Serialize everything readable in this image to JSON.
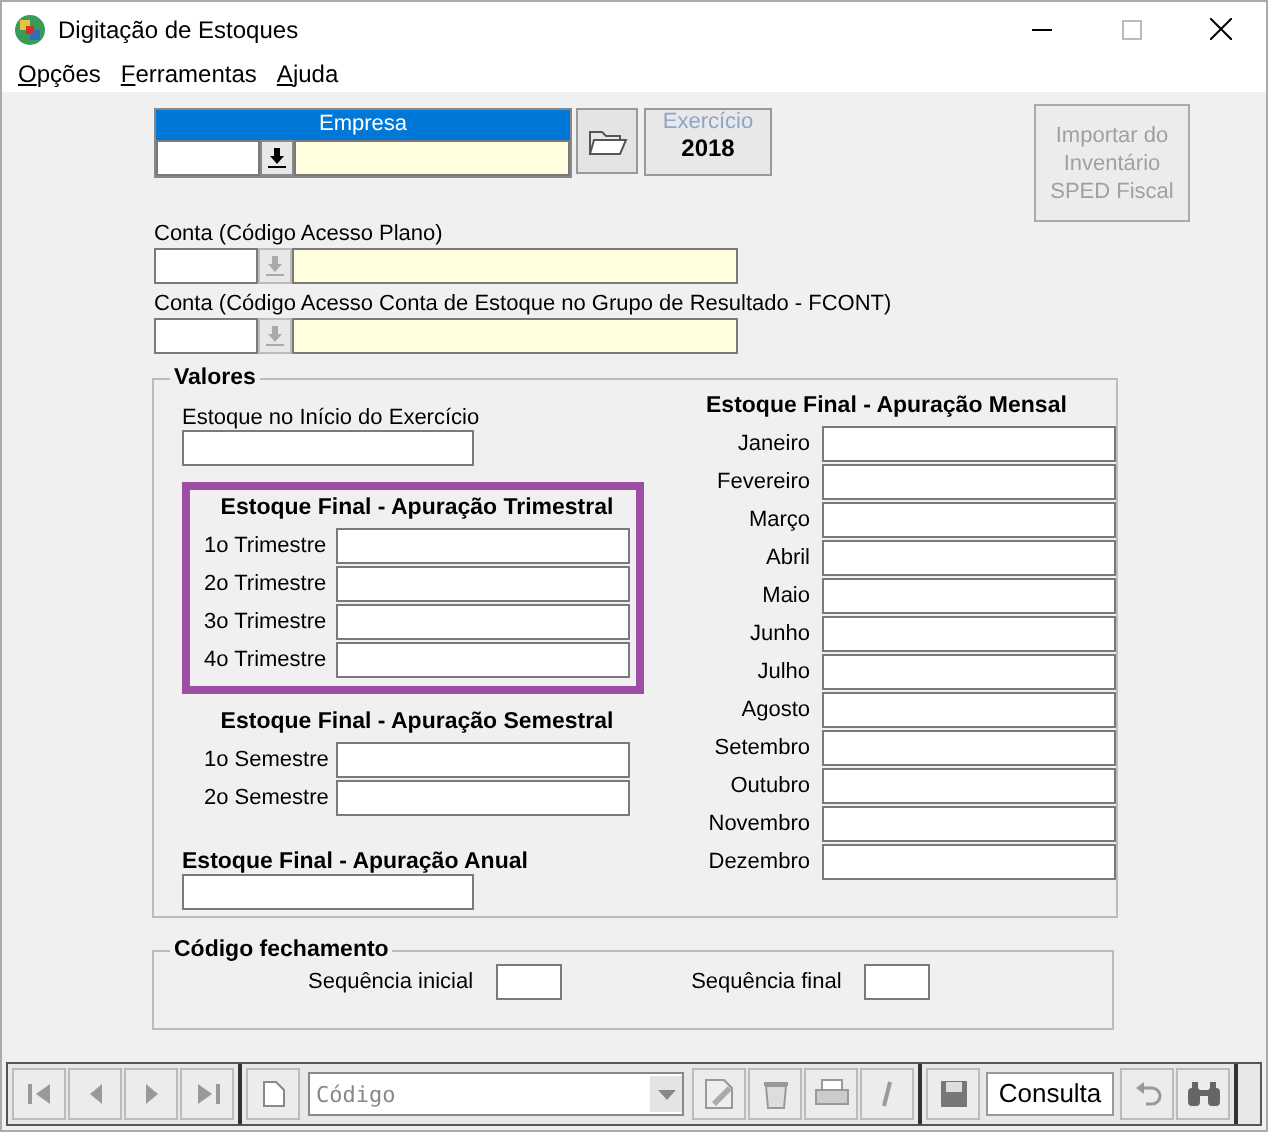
{
  "window": {
    "title": "Digitação de Estoques"
  },
  "menu": [
    {
      "label": "Opções"
    },
    {
      "label": "Ferramentas"
    },
    {
      "label": "Ajuda"
    }
  ],
  "empresa": {
    "header": "Empresa"
  },
  "exercicio": {
    "label": "Exercício",
    "value": "2018"
  },
  "import_button": {
    "label": "Importar do Inventário SPED Fiscal",
    "disabled": true
  },
  "contas": [
    {
      "label": "Conta (Código Acesso Plano)"
    },
    {
      "label": "Conta (Código Acesso Conta de Estoque no Grupo de Resultado - FCONT)"
    }
  ],
  "valores": {
    "title": "Valores",
    "inicio": {
      "label": "Estoque no Início do Exercício"
    },
    "trimestral": {
      "title": "Estoque Final - Apuração Trimestral",
      "highlighted": true,
      "rows": [
        {
          "label": "1o Trimestre"
        },
        {
          "label": "2o Trimestre"
        },
        {
          "label": "3o Trimestre"
        },
        {
          "label": "4o Trimestre"
        }
      ]
    },
    "semestral": {
      "title": "Estoque Final - Apuração Semestral",
      "rows": [
        {
          "label": "1o Semestre"
        },
        {
          "label": "2o Semestre"
        }
      ]
    },
    "anual": {
      "title": "Estoque Final - Apuração Anual"
    },
    "mensal": {
      "title": "Estoque Final - Apuração Mensal",
      "rows": [
        {
          "label": "Janeiro"
        },
        {
          "label": "Fevereiro"
        },
        {
          "label": "Março"
        },
        {
          "label": "Abril"
        },
        {
          "label": "Maio"
        },
        {
          "label": "Junho"
        },
        {
          "label": "Julho"
        },
        {
          "label": "Agosto"
        },
        {
          "label": "Setembro"
        },
        {
          "label": "Outubro"
        },
        {
          "label": "Novembro"
        },
        {
          "label": "Dezembro"
        }
      ]
    }
  },
  "codigo_fechamento": {
    "title": "Código fechamento",
    "fields": [
      {
        "label": "Sequência inicial"
      },
      {
        "label": "Sequência final"
      }
    ]
  },
  "toolbar": {
    "search": {
      "placeholder": "Código"
    },
    "mode": "Consulta"
  }
}
